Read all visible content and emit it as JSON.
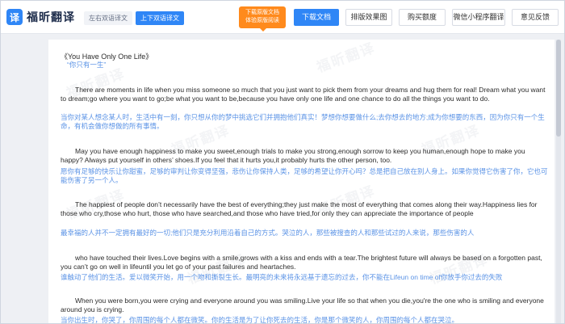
{
  "app": {
    "logo_mark": "译",
    "logo_text": "福昕翻译"
  },
  "header": {
    "mode_left": "左右双语译文",
    "mode_top_bottom": "上下双语译文",
    "promo_line1": "下载原版文档",
    "promo_line2": "体验原版阅读",
    "download_label": "下载文档",
    "layout_effect_label": "排版效果图",
    "buy_quota_label": "购买额度",
    "wechat_label": "微信小程序翻译",
    "feedback_label": "意见反馈"
  },
  "watermark_text": "福昕翻译",
  "document": {
    "title_en": "《You Have Only One Life》",
    "title_zh": "“你只有一生”",
    "paragraphs": [
      {
        "en": "There are moments in life when you miss someone so much that you just want to pick them from your dreams and hug them for real! Dream what you want to dream;go where you want to go;be what you want to be,because you have only one life and one chance to do all the things you want to do.",
        "zh": "当你对某人想念某人时，生活中有一刻，你只想从你的梦中挑选它们并拥抱他们真实！梦想你想要做什么;去你想去的地方;成为你想要的东西，因为你只有一个生命，有机会做你想做的所有事情。"
      },
      {
        "en": "May you have enough happiness to make you sweet,enough trials to make you strong,enough sorrow to keep you human,enough hope to make you happy? Always put yourself in others’ shoes.If you feel that it hurts you,it probably hurts the other person, too.",
        "zh": "愿你有足够的快乐让你甜蜜，足够的审判让你变得坚强，悲伤让你保持人类，足够的希望让你开心吗？总是把自己放在别人身上。如果你觉得它伤害了你，它也可能伤害了另一个人。"
      },
      {
        "en": "The happiest of people don’t necessarily have the best of everything;they just make the most of everything that comes along their way.Happiness lies for those who cry,those who hurt, those who have searched,and those who have tried,for only they can appreciate the importance of people",
        "zh": "最幸福的人并不一定拥有最好的一切;他们只是充分利用沿着自己的方式。哭泣的人，那些被搜查的人和那些试过的人来说，那些伤害的人"
      },
      {
        "en": "who have touched their lives.Love begins with a smile,grows with a kiss and ends with a tear.The brightest future will always be based on a forgotten past, you can’t go on well in lifeuntil you let go of your past failures and heartaches.",
        "zh": "谁触动了他们的生活。爱以微笑开始，用一个吻和撕裂生长。最明亮的未来将永远基于遗忘的过去，你不能在Lifeun on time of你放手你过去的失败"
      },
      {
        "en": "When you were born,you were crying and everyone around you was smiling.Live your life so that when you die,you're the one who is smiling and everyone around you is crying.",
        "zh": "当你出生时，你哭了，你周围的每个人都在微笑。你的生活是为了让你死去的生活，你是那个微笑的人，你周围的每个人都在哭泣。"
      }
    ]
  },
  "colors": {
    "brand": "#2f86f6",
    "promo": "#ff8a1c",
    "translation_text": "#5b93e6"
  }
}
